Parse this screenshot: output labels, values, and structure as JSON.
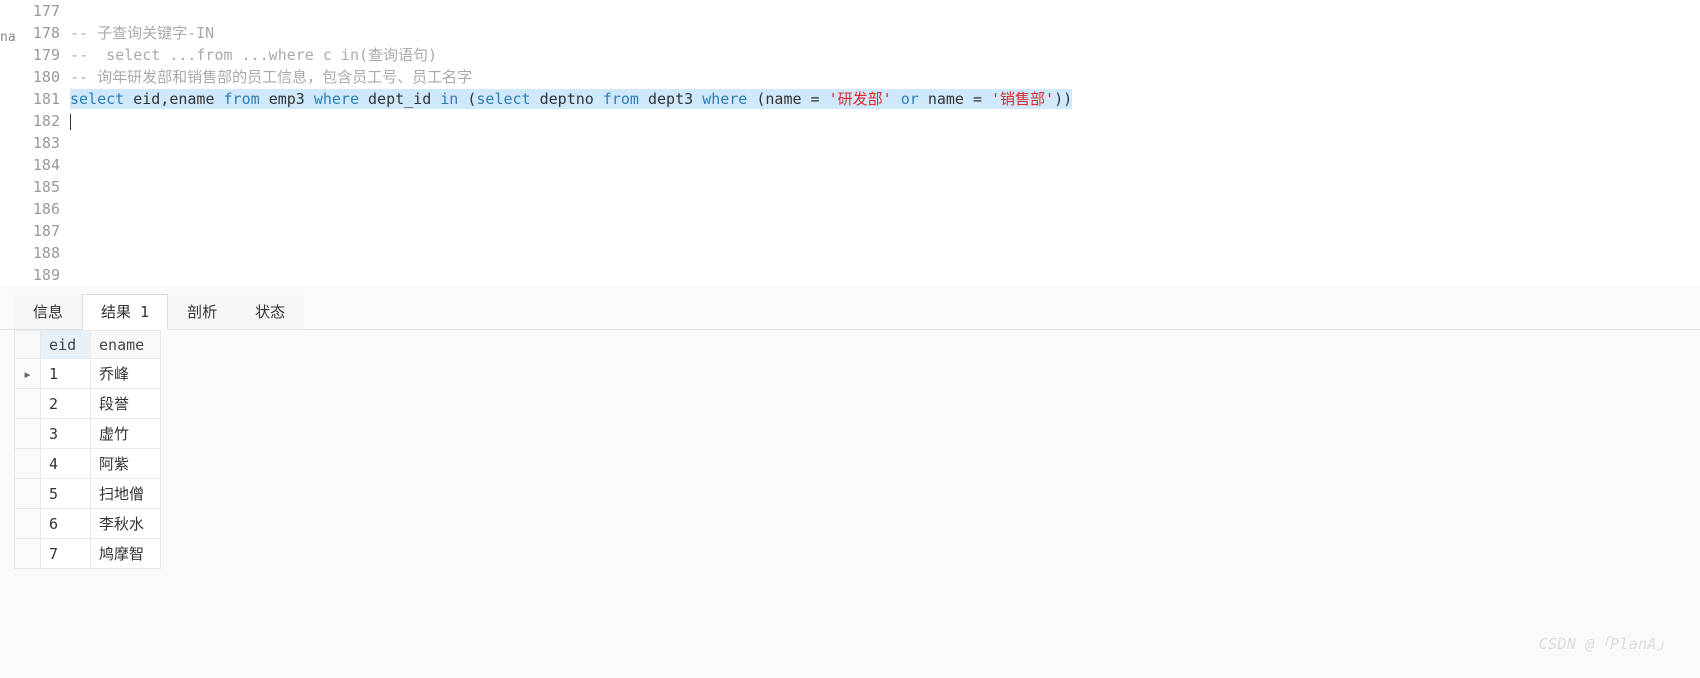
{
  "side_hint": "na",
  "editor": {
    "line_numbers": [
      "177",
      "178",
      "179",
      "180",
      "181",
      "182",
      "183",
      "184",
      "185",
      "186",
      "187",
      "188",
      "189"
    ],
    "lines": {
      "l177": "",
      "l178_prefix": "-- ",
      "l178_comment": "子查询关键字-IN",
      "l179_prefix": "--  ",
      "l179_comment": "select ...from ...where c in(查询语句)",
      "l180_prefix": "-- ",
      "l180_comment": "询年研发部和销售部的员工信息，包含员工号、员工名字",
      "l181": {
        "kw_select": "select",
        "sp1": " ",
        "cols": "eid,ename",
        "sp2": " ",
        "kw_from": "from",
        "sp3": " ",
        "tbl1": "emp3",
        "sp4": " ",
        "kw_where1": "where",
        "sp5": " ",
        "col_dept": "dept_id",
        "sp6": " ",
        "kw_in": "in",
        "sp7": " (",
        "kw_select2": "select",
        "sp8": " ",
        "col_deptno": "deptno",
        "sp9": " ",
        "kw_from2": "from",
        "sp10": " ",
        "tbl2": "dept3",
        "sp11": " ",
        "kw_where2": "where",
        "sp12": " (",
        "col_name1": "name",
        "sp13": " = ",
        "str1": "'研发部'",
        "sp14": " ",
        "kw_or": "or",
        "sp15": " ",
        "col_name2": "name",
        "sp16": " = ",
        "str2": "'销售部'",
        "paren_close": "))"
      }
    }
  },
  "tabs": {
    "info": "信息",
    "result1": "结果 1",
    "profile": "剖析",
    "status": "状态"
  },
  "result": {
    "columns": {
      "eid": "eid",
      "ename": "ename"
    },
    "rows": [
      {
        "marker": "▸",
        "eid": "1",
        "ename": "乔峰"
      },
      {
        "marker": "",
        "eid": "2",
        "ename": "段誉"
      },
      {
        "marker": "",
        "eid": "3",
        "ename": "虚竹"
      },
      {
        "marker": "",
        "eid": "4",
        "ename": "阿紫"
      },
      {
        "marker": "",
        "eid": "5",
        "ename": "扫地僧"
      },
      {
        "marker": "",
        "eid": "6",
        "ename": "李秋水"
      },
      {
        "marker": "",
        "eid": "7",
        "ename": "鸠摩智"
      }
    ]
  },
  "watermark": "CSDN @「PlanA」"
}
